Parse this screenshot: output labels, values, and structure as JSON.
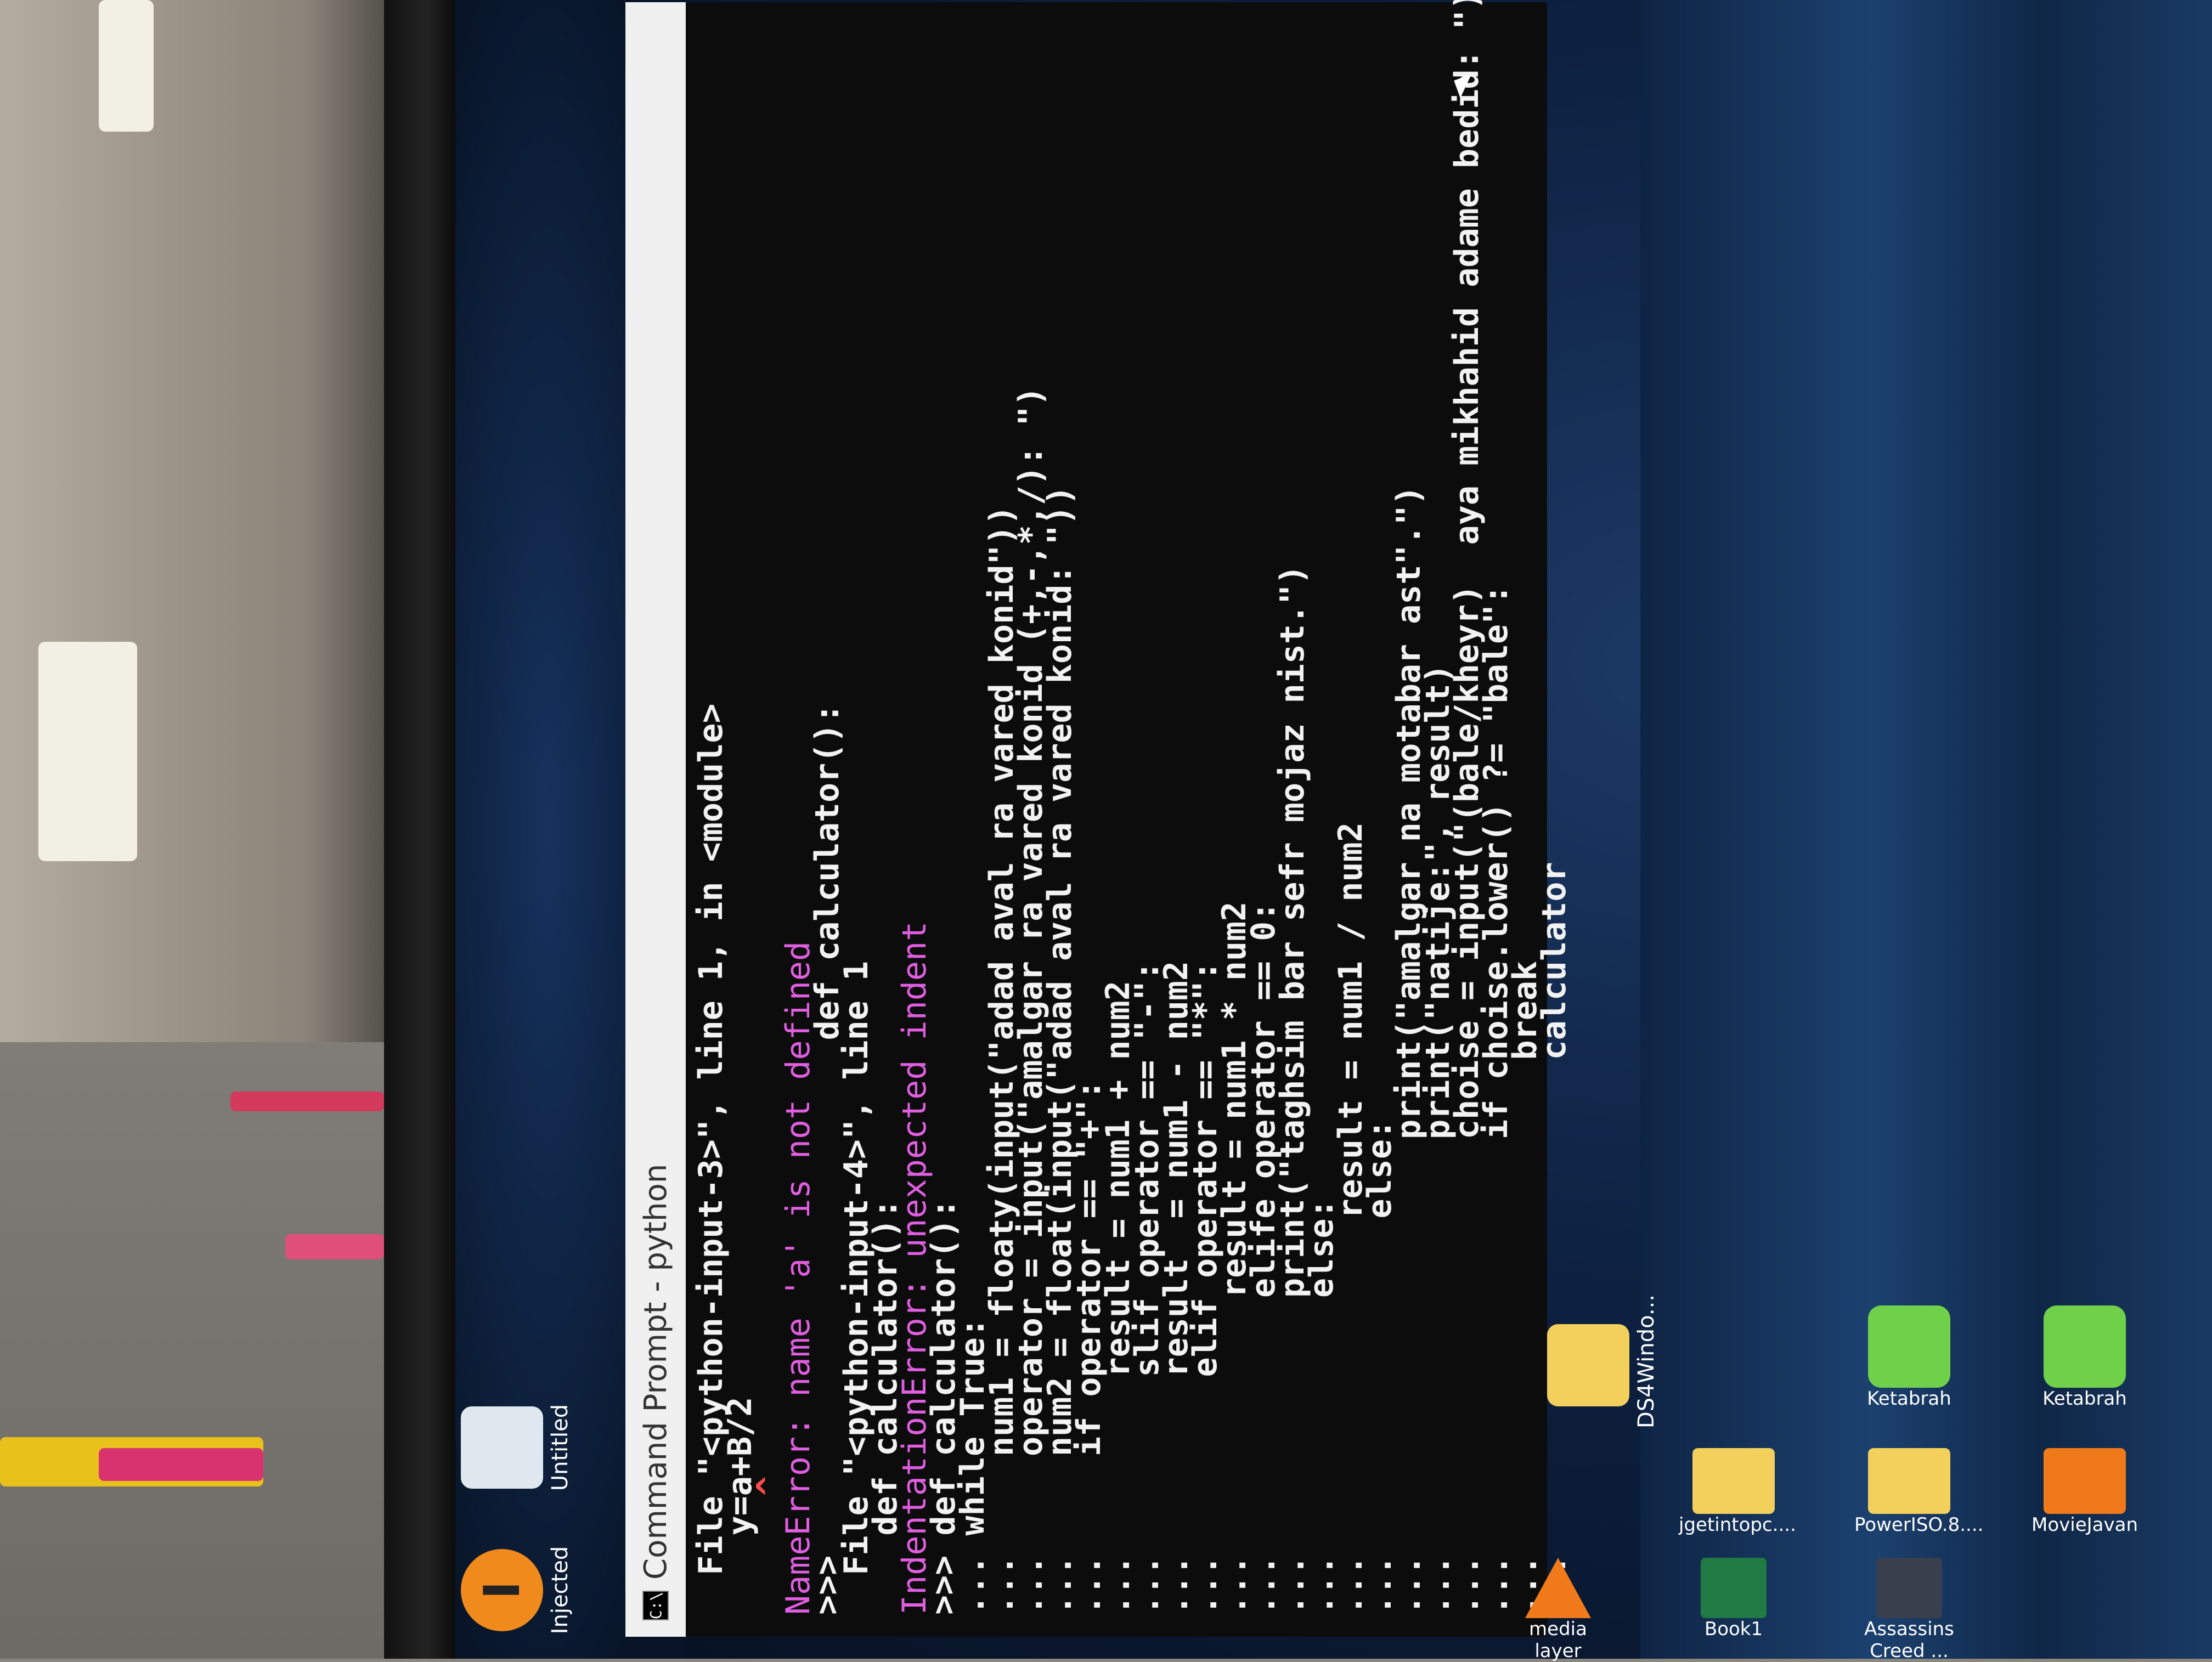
{
  "taskbar": {
    "items": [
      {
        "label": "Injected",
        "icon": "injected-app-icon"
      },
      {
        "label": "Untitled",
        "icon": "document-icon"
      }
    ]
  },
  "desktop_icons": [
    {
      "label": "DS4Windo...",
      "icon": "folder-icon"
    },
    {
      "label": "Ketabrah",
      "icon": "ketabrah-icon"
    },
    {
      "label": "Ketabrah",
      "icon": "ketabrah-icon"
    },
    {
      "label": "jgetintopc....",
      "icon": "folder-icon"
    },
    {
      "label": "PowerISO.8....",
      "icon": "folder-icon"
    },
    {
      "label": "MovieJavan",
      "icon": "moviejavan-icon"
    },
    {
      "label": "media layer",
      "icon": "vlc-icon"
    },
    {
      "label": "Book1",
      "icon": "excel-icon"
    },
    {
      "label": "Assassins Creed ...",
      "icon": "game-icon"
    }
  ],
  "window": {
    "title": "Command Prompt - python",
    "icon": "cmd-icon"
  },
  "console_lines": [
    {
      "text": "  File \"<python-input-3>\", line 1, in <module>",
      "style": "normal"
    },
    {
      "text": "    y=a+B/2",
      "style": "normal"
    },
    {
      "text": "      ^",
      "style": "error"
    },
    {
      "text": "NameError: name 'a' is not defined",
      "style": "magenta"
    },
    {
      "text": ">>>                          def calculator():",
      "style": "normal"
    },
    {
      "text": "  File \"<python-input-4>\", line 1",
      "style": "normal"
    },
    {
      "text": "    def calculator():",
      "style": "normal"
    },
    {
      "text": "IndentationError: unexpected indent",
      "style": "magenta"
    },
    {
      "text": ">>> def calculator():",
      "style": "normal"
    },
    {
      "text": "... while True:",
      "style": "normal"
    },
    {
      "text": "...     num1 = floaty(input(\"adad aval ra vared konid\"))",
      "style": "normal"
    },
    {
      "text": "...     operator = input(\"amalgar ra vared konid (+,-,*,/): \")",
      "style": "normal"
    },
    {
      "text": "...     num2 = float(input(\"adad aval ra vared konid: \"))",
      "style": "normal"
    },
    {
      "text": "...     if operator == \"+\":",
      "style": "normal"
    },
    {
      "text": "...         result = num1 + num2",
      "style": "normal"
    },
    {
      "text": "...         slif operator == \"-\":",
      "style": "normal"
    },
    {
      "text": "...         result  = num1 - num2",
      "style": "normal"
    },
    {
      "text": "...         elif operator == \"*\":",
      "style": "normal"
    },
    {
      "text": "...             result = num1 * num2",
      "style": "normal"
    },
    {
      "text": "...             elife operator == 0:",
      "style": "normal"
    },
    {
      "text": "...             print(\"taghsim bar sefr mojaz nist.\")",
      "style": "normal"
    },
    {
      "text": "...             else:",
      "style": "normal"
    },
    {
      "text": "...                 result = num1 / num2",
      "style": "normal"
    },
    {
      "text": "...                 else:",
      "style": "normal"
    },
    {
      "text": "...                     print(\"amalgar na motabar ast\".\")",
      "style": "normal"
    },
    {
      "text": "...                     print(\"natije:\", result)",
      "style": "normal"
    },
    {
      "text": "...                     choise = input(\"(bale/kheyr)  aya mikhahid adame bedid: \")",
      "style": "normal"
    },
    {
      "text": "...                     if choise.lower() ?= \"bale\":",
      "style": "normal"
    },
    {
      "text": "...                         break",
      "style": "normal"
    },
    {
      "text": "...                         calculator",
      "style": "normal"
    }
  ]
}
